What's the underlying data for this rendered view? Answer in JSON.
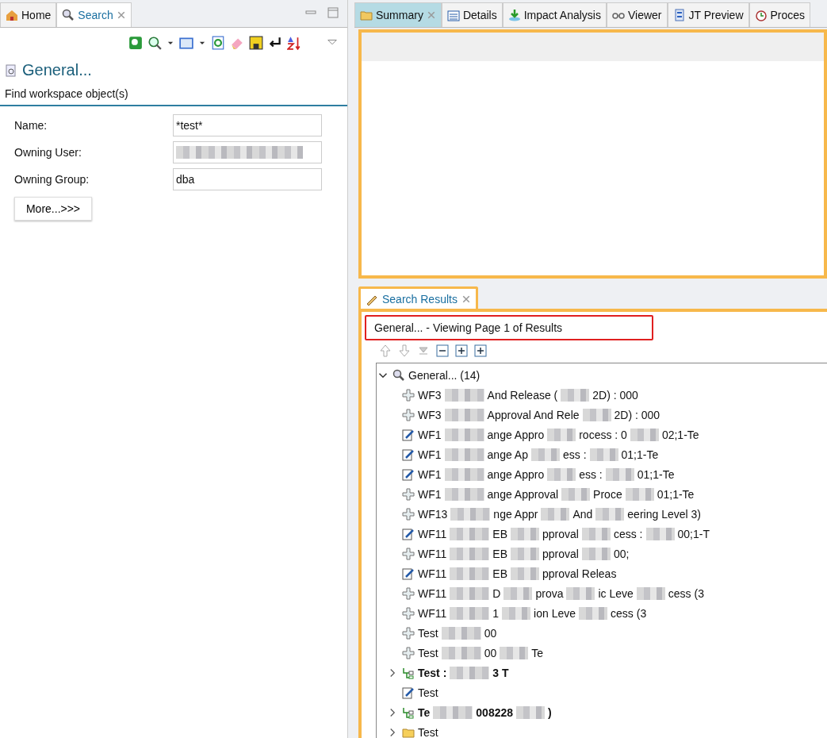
{
  "left_tabs": [
    {
      "label": "Home",
      "selected": false,
      "closable": false
    },
    {
      "label": "Search",
      "selected": true,
      "closable": true
    }
  ],
  "search_panel": {
    "title": "General...",
    "subtitle": "Find workspace object(s)",
    "fields": [
      {
        "label": "Name:",
        "value": "*test*",
        "blurred": false
      },
      {
        "label": "Owning User:",
        "blurred": true
      },
      {
        "label": "Owning Group:",
        "value": "dba",
        "blurred": false
      }
    ],
    "more_button": "More...>>>"
  },
  "right_tabs": [
    {
      "label": "Summary",
      "selected": true,
      "closable": true
    },
    {
      "label": "Details",
      "selected": false,
      "closable": false
    },
    {
      "label": "Impact Analysis",
      "selected": false,
      "closable": false
    },
    {
      "label": "Viewer",
      "selected": false,
      "closable": false
    },
    {
      "label": "JT Preview",
      "selected": false,
      "closable": false
    },
    {
      "label": "Proces",
      "selected": false,
      "closable": false
    }
  ],
  "results": {
    "tab": "Search Results",
    "header": "General... - Viewing Page 1 of Results",
    "header_highlighted": true,
    "tree": {
      "label": "General... (14)",
      "expanded": true,
      "children": [
        {
          "kind": "workflow",
          "bold": false,
          "expandable": false,
          "parts": [
            "WF3",
            "And Release (",
            "2D) : 000"
          ]
        },
        {
          "kind": "workflow",
          "bold": false,
          "expandable": false,
          "parts": [
            "WF3",
            "Approval And Rele",
            "2D) : 000"
          ]
        },
        {
          "kind": "task",
          "bold": false,
          "expandable": false,
          "parts": [
            "WF1",
            "ange Appro",
            "rocess : 0",
            "02;1-Te"
          ]
        },
        {
          "kind": "task",
          "bold": false,
          "expandable": false,
          "parts": [
            "WF1",
            "ange Ap",
            "ess : ",
            "01;1-Te"
          ]
        },
        {
          "kind": "task",
          "bold": false,
          "expandable": false,
          "parts": [
            "WF1",
            "ange Appro",
            "ess : ",
            "01;1-Te"
          ]
        },
        {
          "kind": "workflow",
          "bold": false,
          "expandable": false,
          "parts": [
            "WF1",
            "ange Approval",
            "Proce",
            "01;1-Te"
          ]
        },
        {
          "kind": "workflow",
          "bold": false,
          "expandable": false,
          "parts": [
            "WF13",
            "nge Appr",
            "And",
            "eering Level 3)"
          ]
        },
        {
          "kind": "task",
          "bold": false,
          "expandable": false,
          "parts": [
            "WF11",
            "EB",
            "pproval",
            "cess : ",
            "00;1-T"
          ]
        },
        {
          "kind": "workflow",
          "bold": false,
          "expandable": false,
          "parts": [
            "WF11",
            "EB",
            "pproval",
            "00;"
          ]
        },
        {
          "kind": "task",
          "bold": false,
          "expandable": false,
          "parts": [
            "WF11",
            "EB",
            "pproval Releas"
          ]
        },
        {
          "kind": "workflow",
          "bold": false,
          "expandable": false,
          "parts": [
            "WF11",
            "D",
            "prova",
            "ic Leve",
            "cess (3"
          ]
        },
        {
          "kind": "workflow",
          "bold": false,
          "expandable": false,
          "parts": [
            "WF11",
            "1",
            "ion Leve",
            "cess (3"
          ]
        },
        {
          "kind": "workflow",
          "bold": false,
          "expandable": false,
          "parts": [
            "Test",
            "00"
          ]
        },
        {
          "kind": "workflow",
          "bold": false,
          "expandable": false,
          "parts": [
            "Test",
            "00",
            "Te"
          ]
        },
        {
          "kind": "process",
          "bold": true,
          "expandable": true,
          "parts": [
            "Test :",
            "3 T"
          ]
        },
        {
          "kind": "task",
          "bold": false,
          "expandable": false,
          "parts": [
            "Test"
          ]
        },
        {
          "kind": "process",
          "bold": true,
          "expandable": true,
          "parts": [
            "Te",
            "008228",
            ")"
          ]
        },
        {
          "kind": "folder",
          "bold": false,
          "expandable": true,
          "parts": [
            "Test"
          ]
        }
      ]
    }
  }
}
